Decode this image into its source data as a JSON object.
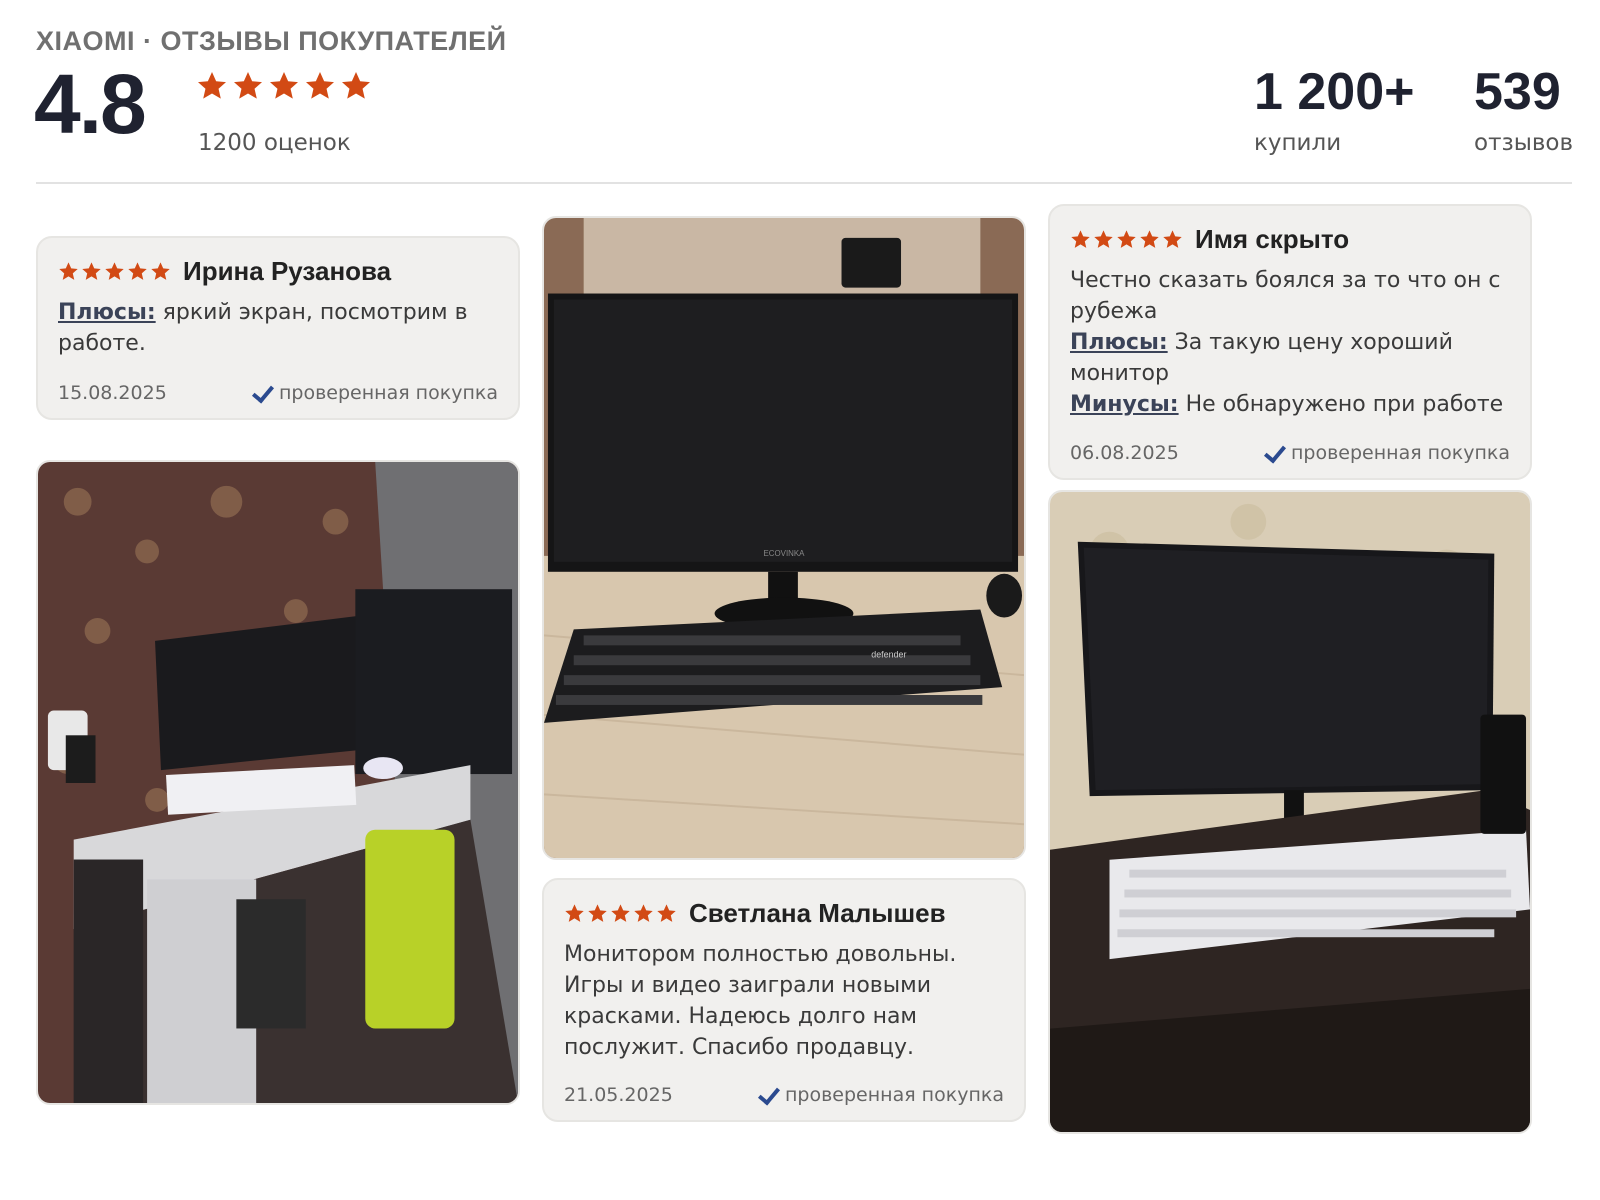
{
  "header": {
    "brand": "XIAOMI · ОТЗЫВЫ ПОКУПАТЕЛЕЙ",
    "rating": "4.8",
    "rating_count": "1200 оценок",
    "stars": 5,
    "bought_value": "1 200+",
    "bought_label": "купили",
    "reviews_value": "539",
    "reviews_label": "отзывов"
  },
  "colors": {
    "star": "#d24a14",
    "check": "#2b4a8f",
    "card_bg": "#f1f0ee"
  },
  "reviews": [
    {
      "name": "Ирина Рузанова",
      "stars": 5,
      "pros_label": "Плюсы:",
      "pros": "яркий экран, посмотрим в работе.",
      "date": "15.08.2025",
      "verified": "проверенная покупка"
    },
    {
      "name": "Имя скрыто",
      "stars": 5,
      "text": "Честно сказать боялся за то что он с рубежа",
      "pros_label": "Плюсы:",
      "pros": "За такую цену хороший монитор",
      "cons_label": "Минусы:",
      "cons": "Не обнаружено при работе",
      "date": "06.08.2025",
      "verified": "проверенная покупка"
    },
    {
      "name": "Светлана Малышев",
      "stars": 5,
      "text": "Монитором полностью довольны. Игры и видео заиграли новыми красками. Надеюсь долго нам послужит. Спасибо продавцу.",
      "date": "21.05.2025",
      "verified": "проверенная покупка"
    }
  ],
  "photos": {
    "monitor_brand": "ECOVINKA",
    "keyboard_brand": "defender"
  }
}
